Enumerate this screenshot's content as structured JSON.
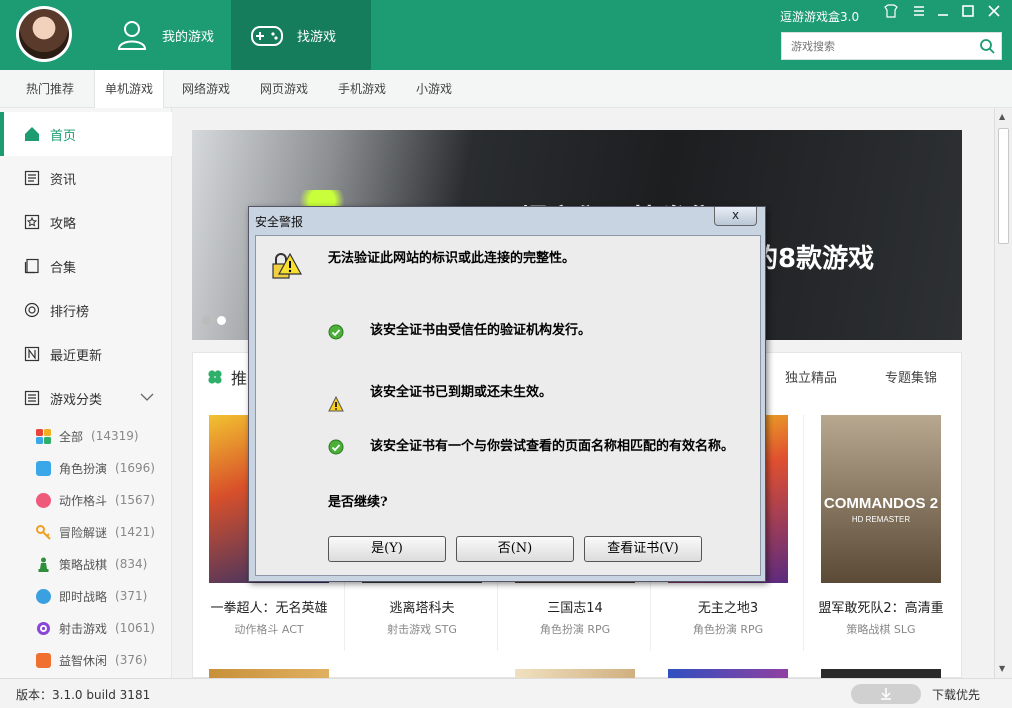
{
  "header": {
    "tabs": [
      {
        "label": "我的游戏",
        "icon": "user-icon"
      },
      {
        "label": "找游戏",
        "icon": "gamepad-icon"
      }
    ],
    "app_title": "逗游游戏盒3.0",
    "search_placeholder": "游戏搜索"
  },
  "subnav": [
    "热门推荐",
    "单机游戏",
    "网络游戏",
    "网页游戏",
    "手机游戏",
    "小游戏"
  ],
  "sidebar": {
    "items": [
      "首页",
      "资讯",
      "攻略",
      "合集",
      "排行榜",
      "最近更新",
      "游戏分类"
    ],
    "categories": [
      {
        "label": "全部",
        "count": "(14319)",
        "color": "#e8443a"
      },
      {
        "label": "角色扮演",
        "count": "(1696)",
        "color": "#3aa7e8"
      },
      {
        "label": "动作格斗",
        "count": "(1567)",
        "color": "#f05a7a"
      },
      {
        "label": "冒险解谜",
        "count": "(1421)",
        "color": "#f0a020"
      },
      {
        "label": "策略战棋",
        "count": "(834)",
        "color": "#2f8f3a"
      },
      {
        "label": "即时战略",
        "count": "(371)",
        "color": "#3aa0e0"
      },
      {
        "label": "射击游戏",
        "count": "(1061)",
        "color": "#8a46d8"
      },
      {
        "label": "益智休闲",
        "count": "(376)",
        "color": "#f07030"
      }
    ]
  },
  "banner": {
    "text_top": "只爆它们尽快发售!",
    "text_bottom": "的8款游戏"
  },
  "panel": {
    "title": "推",
    "tabs": [
      "独立精品",
      "专题集锦"
    ],
    "games": [
      {
        "name": "一拳超人：无名英雄",
        "tag": "动作格斗 ACT"
      },
      {
        "name": "逃离塔科夫",
        "tag": "射击游戏 STG"
      },
      {
        "name": "三国志14",
        "tag": "角色扮演 RPG"
      },
      {
        "name": "无主之地3",
        "tag": "角色扮演 RPG"
      },
      {
        "name": "盟军敢死队2：高清重",
        "tag": "策略战棋 SLG"
      }
    ],
    "cover_text": "COMMANDOS 2",
    "cover_sub": "HD REMASTER"
  },
  "footer": {
    "version": "版本：3.1.0 build 3181",
    "download_priority": "下载优先"
  },
  "dialog": {
    "title": "安全警报",
    "close": "x",
    "header_msg": "无法验证此网站的标识或此连接的完整性。",
    "items": [
      {
        "text": "该安全证书由受信任的验证机构发行。",
        "icon": "check-icon"
      },
      {
        "text": "该安全证书已到期或还未生效。",
        "icon": "warning-icon"
      },
      {
        "text": "该安全证书有一个与你尝试查看的页面名称相匹配的有效名称。",
        "icon": "check-icon"
      }
    ],
    "question": "是否继续?",
    "buttons": {
      "yes": "是(Y)",
      "no": "否(N)",
      "view": "查看证书(V)"
    }
  }
}
